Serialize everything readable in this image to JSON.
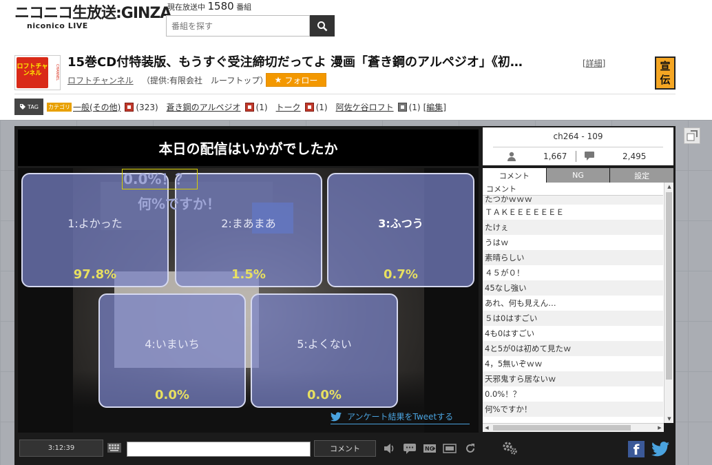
{
  "header": {
    "logo_main": "ニコニコ生放送:GINZA",
    "logo_sub": "niconico LIVE",
    "onair_prefix": "現在放送中",
    "onair_count": "1580",
    "onair_suffix": "番組",
    "search_placeholder": "番組を探す"
  },
  "program": {
    "thumb_text": "ロフトチャンネル",
    "thumb_side": "CHANNEL",
    "title": "15巻CD付特装版、もうすぐ受注締切だってよ 漫画「蒼き鋼のアルペジオ」《初…",
    "detail_link": "[詳細]",
    "channel": "ロフトチャンネル",
    "provider": "（提供:有限会社　ルーフトップ）",
    "follow_label": "フォロー",
    "ad_label": "宣伝"
  },
  "tags": {
    "icon_label": "TAG",
    "category_badge": "カテゴリ",
    "items": [
      {
        "name": "一般(その他)",
        "count": "(323)",
        "lock": "red"
      },
      {
        "name": "蒼き鋼のアルペジオ",
        "count": "(1)",
        "lock": "red"
      },
      {
        "name": "トーク",
        "count": "(1)",
        "lock": "red"
      },
      {
        "name": "阿佐ケ谷ロフト",
        "count": "(1)",
        "lock": "grey"
      }
    ],
    "edit_label": "[編集]"
  },
  "player": {
    "question": "本日の配信はいかがでしたか",
    "overlay_title": "0.0%！？",
    "overlay_sub": "何%ですか！",
    "poll": [
      {
        "label": "1:よかった",
        "percent": "97.8%",
        "value": 97.8
      },
      {
        "label": "2:まあまあ",
        "percent": "1.5%",
        "value": 1.5
      },
      {
        "label": "3:ふつう",
        "percent": "0.7%",
        "value": 0.7
      },
      {
        "label": "4:いまいち",
        "percent": "0.0%",
        "value": 0.0
      },
      {
        "label": "5:よくない",
        "percent": "0.0%",
        "value": 0.0
      }
    ],
    "tweet_label": "アンケート結果をTweetする"
  },
  "stats": {
    "channel_id": "ch264 - 109",
    "views": "1,667",
    "comments": "2,495"
  },
  "comment_panel": {
    "tabs": [
      "コメント",
      "NG",
      "設定"
    ],
    "header": "コメント",
    "rows": [
      "たつかｗｗｗ",
      "ＴＡＫＥＥＥＥＥＥＥ",
      "たけぇ",
      "うはｗ",
      "素晴らしい",
      "４５が０！",
      "45なし強い",
      "あれ、何も見えん…",
      "５は0はすごい",
      "4も0はすごい",
      "4と5が0は初めて見たｗ",
      "4，5無いぞｗｗ",
      "天邪鬼すら居ないｗ",
      "0.0%！？",
      "何%ですか！"
    ]
  },
  "controls": {
    "time": "3:12:39",
    "comment_button": "コメント"
  },
  "colors": {
    "accent_orange": "#f39800",
    "poll_panel": "#7882c8",
    "percent_yellow": "#e8e060",
    "facebook": "#3b5998",
    "twitter": "#4aa3df"
  }
}
